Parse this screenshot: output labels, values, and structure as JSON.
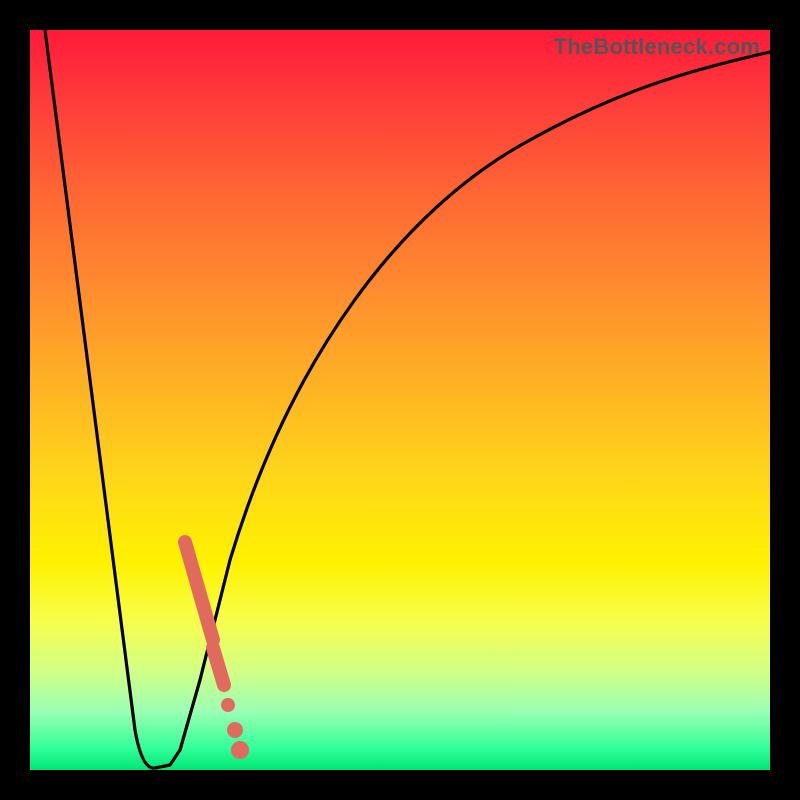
{
  "watermark": "TheBottleneck.com",
  "chart_data": {
    "type": "line",
    "title": "",
    "xlabel": "",
    "ylabel": "",
    "xlim": [
      0,
      100
    ],
    "ylim": [
      0,
      100
    ],
    "grid": false,
    "legend": false,
    "series": [
      {
        "name": "bottleneck-curve",
        "x": [
          2,
          4,
          6,
          8,
          10,
          12,
          14,
          16,
          18,
          20,
          22,
          25,
          30,
          35,
          40,
          45,
          50,
          55,
          60,
          65,
          70,
          75,
          80,
          85,
          90,
          95,
          100
        ],
        "values": [
          100,
          83,
          66,
          49,
          32,
          15,
          2,
          0,
          2,
          8,
          17,
          30,
          46,
          58,
          67,
          74,
          79,
          83.5,
          86.5,
          89,
          91,
          92.5,
          93.8,
          94.8,
          95.6,
          96.3,
          97
        ]
      }
    ],
    "colors": {
      "curve": "#000000",
      "marker": "#e06a5e",
      "background_top": "#ff1a3a",
      "background_bottom": "#00e676"
    },
    "annotations": [
      {
        "type": "exclamation-marker",
        "x": 22.5,
        "y_top": 31,
        "y_bottom": 3,
        "dot_y": 1.5
      }
    ]
  }
}
